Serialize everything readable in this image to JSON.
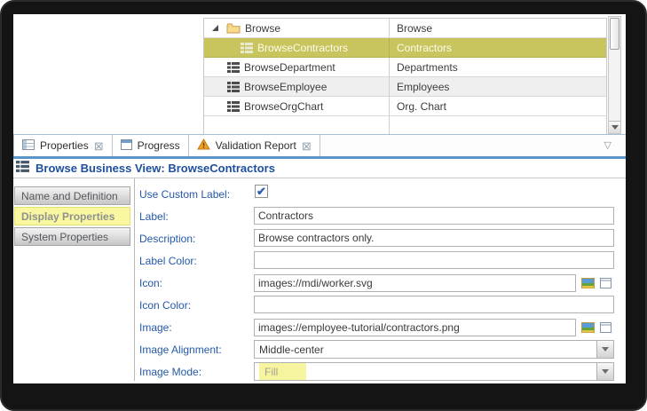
{
  "tree": {
    "rows": [
      {
        "name": "Browse",
        "label": "Browse",
        "icon": "folder-icon",
        "expanded": true
      },
      {
        "name": "BrowseContractors",
        "label": "Contractors",
        "icon": "business-view-icon",
        "selected": true
      },
      {
        "name": "BrowseDepartment",
        "label": "Departments",
        "icon": "business-view-icon"
      },
      {
        "name": "BrowseEmployee",
        "label": "Employees",
        "icon": "business-view-icon"
      },
      {
        "name": "BrowseOrgChart",
        "label": "Org. Chart",
        "icon": "business-view-icon"
      }
    ]
  },
  "tabs": [
    {
      "label": "Properties",
      "icon": "properties-icon",
      "active": true,
      "closable": true
    },
    {
      "label": "Progress",
      "icon": "progress-window-icon",
      "active": false,
      "closable": false
    },
    {
      "label": "Validation Report",
      "icon": "warning-icon",
      "active": false,
      "closable": true
    }
  ],
  "panel": {
    "title": "Browse Business View: BrowseContractors",
    "sections": [
      {
        "label": "Name and Definition",
        "active": false
      },
      {
        "label": "Display Properties",
        "active": true
      },
      {
        "label": "System Properties",
        "active": false
      }
    ],
    "fields": [
      {
        "label": "Use Custom Label:",
        "type": "checkbox",
        "checked": true
      },
      {
        "label": "Label:",
        "type": "text",
        "value": "Contractors"
      },
      {
        "label": "Description:",
        "type": "text",
        "value": "Browse contractors only."
      },
      {
        "label": "Label Color:",
        "type": "text",
        "value": ""
      },
      {
        "label": "Icon:",
        "type": "text-picker",
        "value": "images://mdi/worker.svg"
      },
      {
        "label": "Icon Color:",
        "type": "text",
        "value": ""
      },
      {
        "label": "Image:",
        "type": "text-picker",
        "value": "images://employee-tutorial/contractors.png"
      },
      {
        "label": "Image Alignment:",
        "type": "select",
        "value": "Middle-center"
      },
      {
        "label": "Image Mode:",
        "type": "select",
        "value": "Fill",
        "highlighted": true
      }
    ]
  },
  "glyphs": {
    "close": "⊠",
    "view_menu": "▽",
    "check": "✔"
  },
  "colors": {
    "selection_row": "#c8c45e",
    "section_highlight": "#f9f7a0",
    "value_highlight": "#f7f4a0",
    "label_blue": "#2458a8",
    "title_blue": "#1d4f9e",
    "tab_underline": "#5d94c8"
  }
}
